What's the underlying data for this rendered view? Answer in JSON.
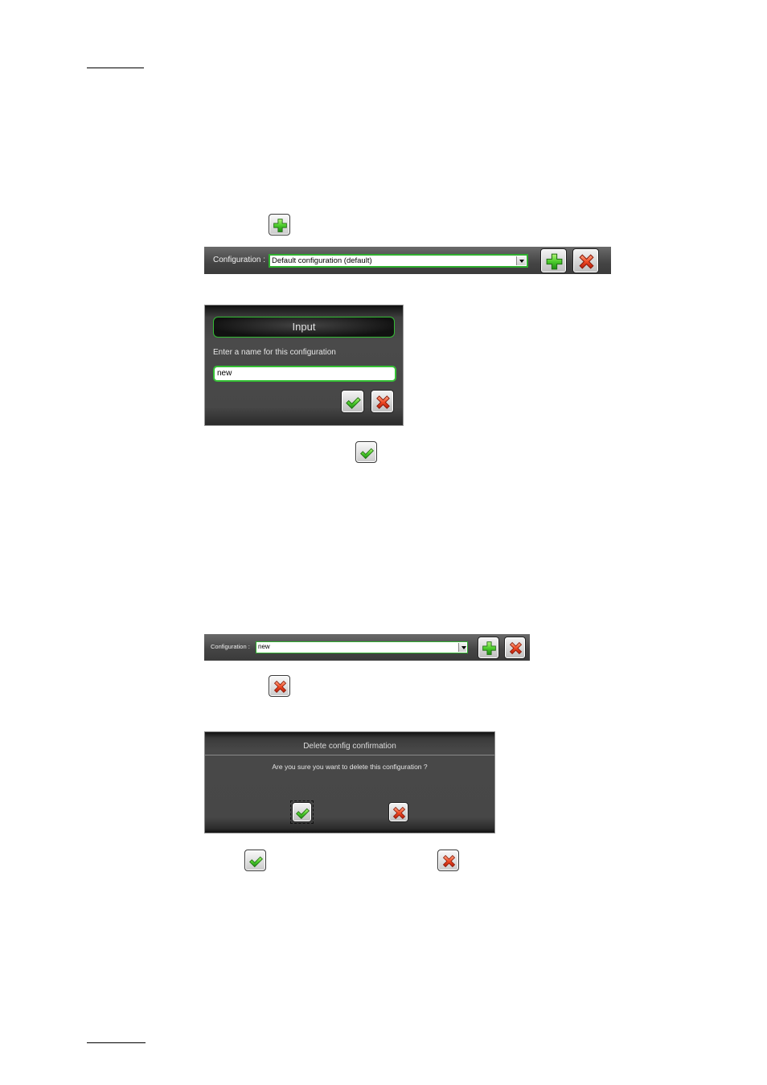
{
  "config_bar_1": {
    "label": "Configuration :",
    "selected": "Default configuration (default)"
  },
  "input_dialog": {
    "title": "Input",
    "prompt": "Enter a name for this configuration",
    "value": "new"
  },
  "config_bar_2": {
    "label": "Configuration :",
    "selected": "new"
  },
  "delete_dialog": {
    "title": "Delete config confirmation",
    "message": "Are you sure you want to delete this configuration ?"
  },
  "icons": {
    "add": "plus-icon",
    "delete": "x-icon",
    "confirm": "check-icon"
  },
  "colors": {
    "accent_green": "#2fae2f",
    "delete_red": "#e23b1f"
  }
}
